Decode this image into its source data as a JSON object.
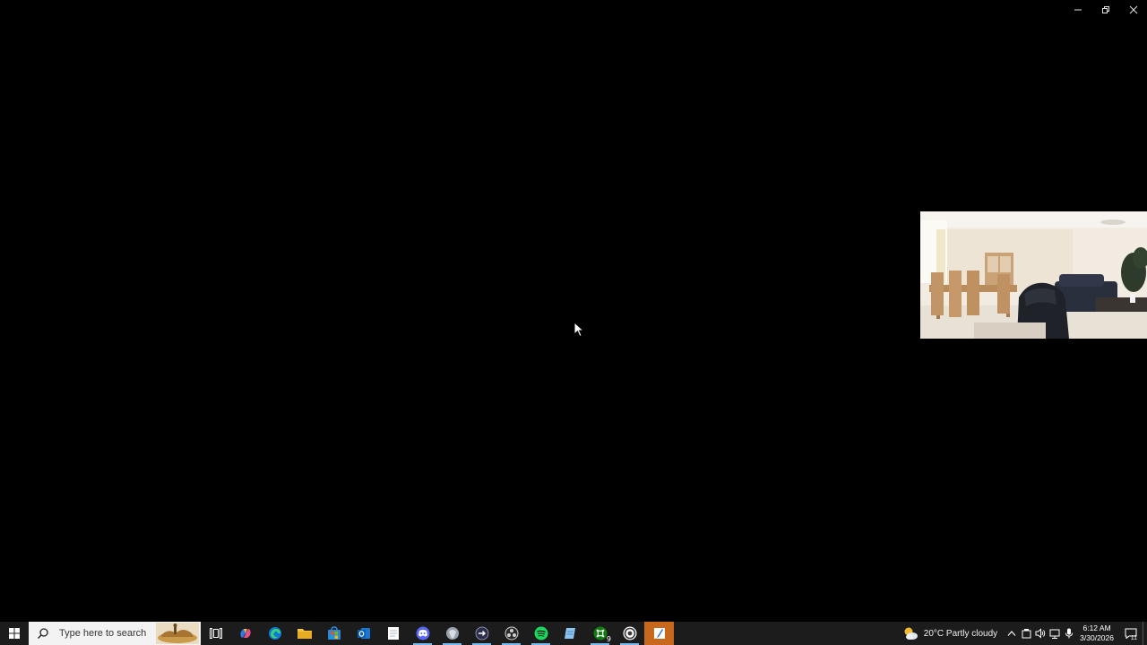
{
  "window": {
    "minimize_label": "Minimize",
    "restore_label": "Restore",
    "close_label": "Close"
  },
  "camera_preview": {
    "description_icon": "camera-feed"
  },
  "taskbar": {
    "search": {
      "placeholder": "Type here to search"
    },
    "apps": [
      {
        "name": "task-view",
        "icon": "task-view-icon"
      },
      {
        "name": "copilot",
        "icon": "copilot-icon"
      },
      {
        "name": "edge",
        "icon": "edge-icon"
      },
      {
        "name": "file-explorer",
        "icon": "folder-icon"
      },
      {
        "name": "microsoft-store",
        "icon": "store-icon"
      },
      {
        "name": "outlook",
        "icon": "outlook-icon"
      },
      {
        "name": "notepad",
        "icon": "notepad-icon"
      },
      {
        "name": "discord",
        "icon": "discord-icon"
      },
      {
        "name": "app-gray",
        "icon": "shield-icon"
      },
      {
        "name": "app-dark",
        "icon": "arrow-circle-icon"
      },
      {
        "name": "obs",
        "icon": "obs-icon"
      },
      {
        "name": "spotify",
        "icon": "spotify-icon"
      },
      {
        "name": "notes",
        "icon": "notes-icon"
      },
      {
        "name": "xbox",
        "icon": "xbox-icon",
        "badge": "9"
      },
      {
        "name": "chrome",
        "icon": "chrome-icon"
      },
      {
        "name": "paint",
        "icon": "paint-icon"
      }
    ],
    "weather": {
      "text": "20°C  Partly cloudy"
    },
    "clock": {
      "time": "6:12 AM",
      "date": "3/30/2026"
    },
    "notifications": {
      "count": "11"
    }
  },
  "colors": {
    "background": "#000000",
    "taskbar": "#1c1c1c",
    "active_indicator": "#76b9ed",
    "highlight_app": "#c8681c"
  }
}
